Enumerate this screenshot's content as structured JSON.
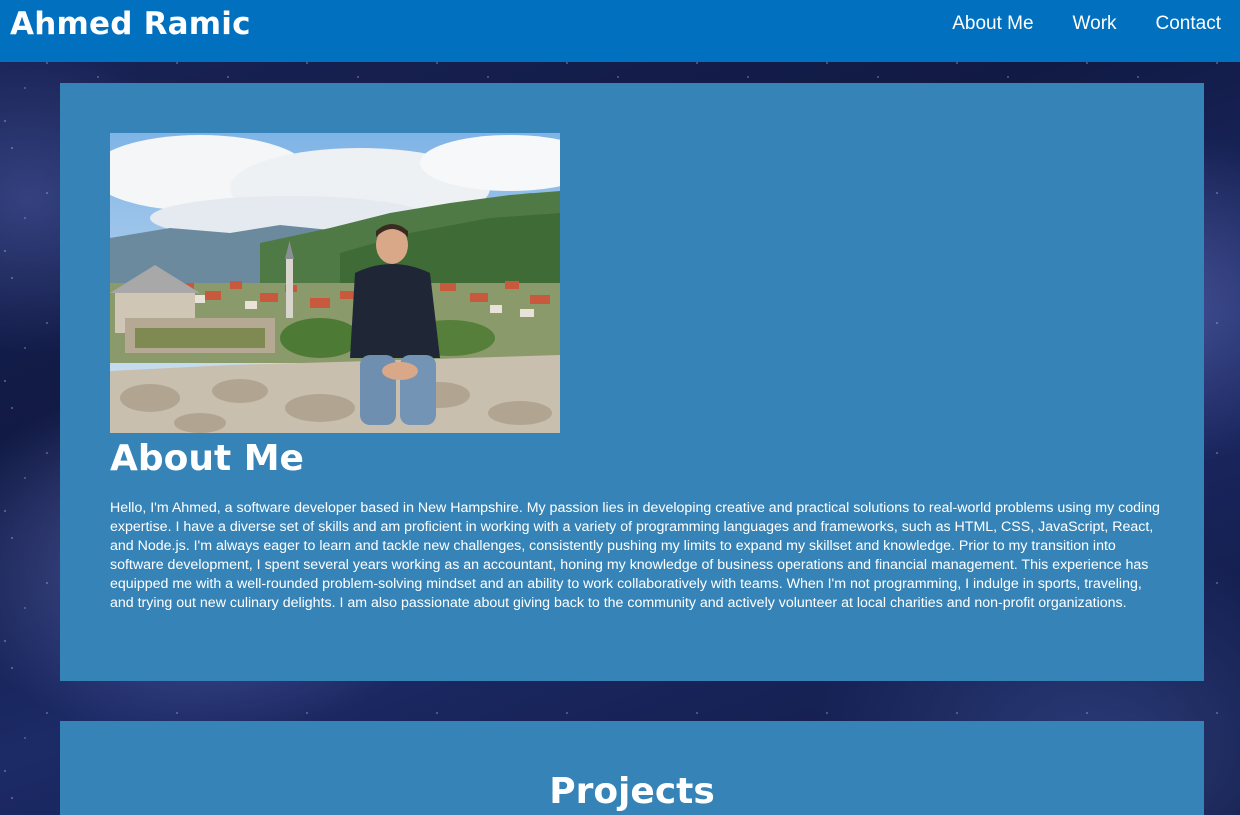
{
  "header": {
    "title": "Ahmed Ramic",
    "nav": [
      {
        "label": "About Me"
      },
      {
        "label": "Work"
      },
      {
        "label": "Contact"
      }
    ]
  },
  "about": {
    "heading": "About Me",
    "body": "Hello, I'm Ahmed, a software developer based in New Hampshire. My passion lies in developing creative and practical solutions to real-world problems using my coding expertise. I have a diverse set of skills and am proficient in working with a variety of programming languages and frameworks, such as HTML, CSS, JavaScript, React, and Node.js. I'm always eager to learn and tackle new challenges, consistently pushing my limits to expand my skillset and knowledge. Prior to my transition into software development, I spent several years working as an accountant, honing my knowledge of business operations and financial management. This experience has equipped me with a well-rounded problem-solving mindset and an ability to work collaboratively with teams. When I'm not programming, I indulge in sports, traveling, and trying out new culinary delights. I am also passionate about giving back to the community and actively volunteer at local charities and non-profit organizations."
  },
  "projects": {
    "heading": "Projects"
  },
  "colors": {
    "header_bg": "#0070bf",
    "panel_bg": "#3684b7",
    "text": "#ffffff"
  }
}
